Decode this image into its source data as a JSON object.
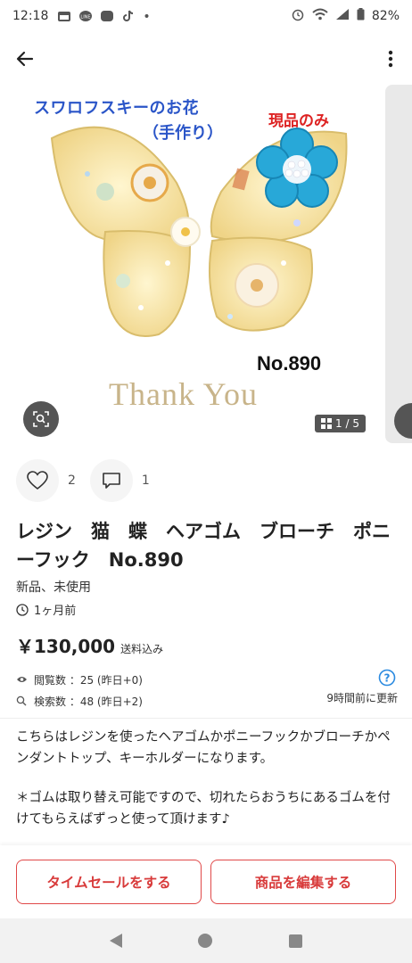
{
  "status_bar": {
    "time": "12:18",
    "dot": "•",
    "battery": "82%"
  },
  "header": {
    "back_icon": "arrow-left-icon",
    "more_icon": "more-vertical-icon"
  },
  "gallery": {
    "image_text": {
      "line1": "スワロフスキーのお花",
      "line2": "（手作り）",
      "stock": "現品のみ",
      "number": "No.890",
      "thanks": "Thank You"
    },
    "counter": "1 / 5"
  },
  "actions": {
    "like_count": "2",
    "comment_count": "1"
  },
  "item": {
    "title": "レジン　猫　蝶　ヘアゴム　ブローチ　ポニーフック　No.890",
    "condition": "新品、未使用",
    "posted": "1ヶ月前",
    "price": "￥130,000",
    "shipping": "送料込み"
  },
  "stats": {
    "views": "閲覧数 ：25 (昨日+0)",
    "searches": "検索数 ：48 (昨日+2)",
    "updated": "9時間前に更新"
  },
  "description": {
    "para1": "こちらはレジンを使ったヘアゴムかポニーフックかブローチかペンダントトップ、キーホルダーになります。",
    "para2": "＊ゴムは取り替え可能ですので、切れたらおうちにあるゴムを付けてもらえばずっと使って頂けます♪"
  },
  "buttons": {
    "timesale": "タイムセールをする",
    "edit": "商品を編集する"
  },
  "colors": {
    "accent": "#e04848",
    "help_blue": "#2a8ae0"
  }
}
